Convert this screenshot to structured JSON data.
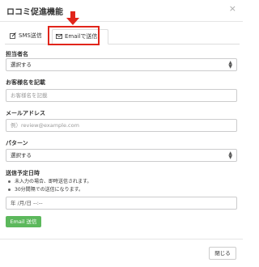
{
  "modal": {
    "title": "ロコミ促進機能",
    "close_icon": "close-icon"
  },
  "tabs": [
    {
      "label": "SMS送信",
      "icon": "edit-icon"
    },
    {
      "label": "Emailで送信",
      "icon": "envelope-icon",
      "active": true
    }
  ],
  "form": {
    "staff": {
      "label": "担当者名",
      "value": "選択する"
    },
    "customer": {
      "label": "お客様名を記載",
      "placeholder": "お客様名を記載"
    },
    "email": {
      "label": "メールアドレス",
      "placeholder": "例）review@example.com"
    },
    "pattern": {
      "label": "パターン",
      "value": "選択する"
    },
    "schedule": {
      "label": "送信予定日時",
      "notes": [
        "未入力の場合、即時送信されます。",
        "30分間隔での送信になります。"
      ],
      "placeholder": "年 /月/日 --:--"
    }
  },
  "buttons": {
    "send": "Email 送信",
    "close": "閉じる"
  },
  "colors": {
    "highlight": "#e1251b",
    "send_button": "#5cb85c"
  }
}
